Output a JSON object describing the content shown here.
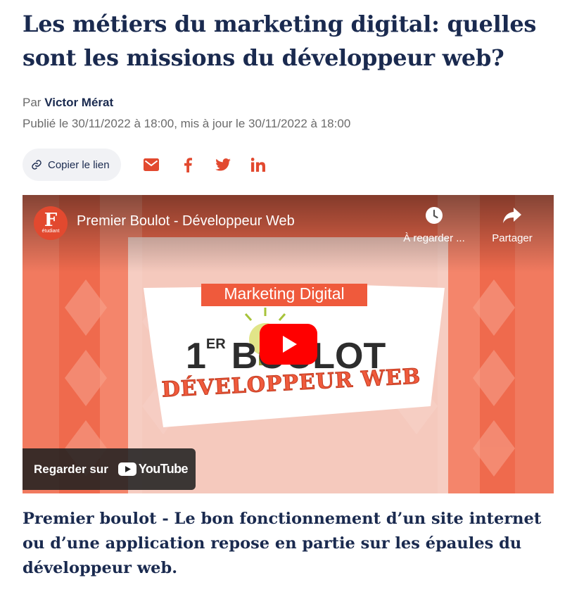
{
  "article": {
    "title": "Les métiers du marketing digital: quelles sont les missions du développeur web?",
    "byline_prefix": "Par",
    "author": "Victor Mérat",
    "dates": "Publié le 30/11/2022 à 18:00, mis à jour le 30/11/2022 à 18:00",
    "caption": "Premier boulot - Le bon fonctionnement d’un site internet ou d’une application repose en partie sur les épaules du développeur web."
  },
  "share": {
    "copy_link_label": "Copier le lien",
    "icons": [
      "link-icon",
      "email-icon",
      "facebook-icon",
      "twitter-icon",
      "linkedin-icon"
    ],
    "accent_color": "#e2492f"
  },
  "video": {
    "channel_logo_text": "F",
    "channel_logo_subtext": "étudiant",
    "title": "Premier Boulot - Développeur Web",
    "watch_later_label": "À regarder ...",
    "share_label": "Partager",
    "thumbnail": {
      "badge": "Marketing Digital",
      "headline_prefix": "1",
      "headline_superscript": "ER",
      "headline_word": "BOULOT",
      "subheadline": "DÉVELOPPEUR WEB"
    },
    "watch_on_label": "Regarder sur",
    "youtube_wordmark": "YouTube",
    "play_button_color": "#ff0000"
  }
}
